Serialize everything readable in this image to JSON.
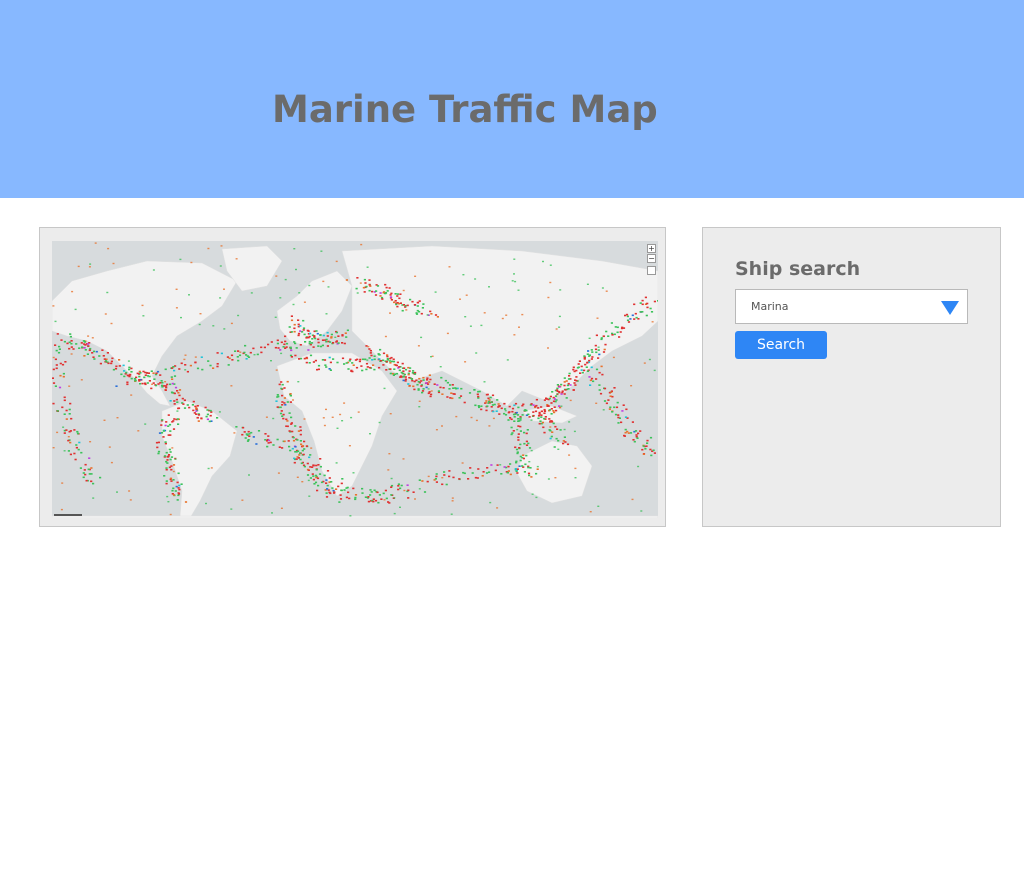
{
  "header": {
    "title": "Marine Traffic Map",
    "background": "#87b8ff"
  },
  "map": {
    "zoom_in": "+",
    "zoom_out": "−",
    "land_color": "#f2f2f2",
    "water_color": "#d7dbdd",
    "ship_colors": [
      "#e03030",
      "#3cc25a",
      "#e8722c",
      "#2a6fd8",
      "#20c4d8",
      "#c040e0"
    ],
    "icons": [
      "zoom-in-icon",
      "zoom-out-icon",
      "layers-icon"
    ]
  },
  "search": {
    "title": "Ship search",
    "selected_option": "Marina",
    "button_label": "Search",
    "accent": "#2e86f5"
  }
}
